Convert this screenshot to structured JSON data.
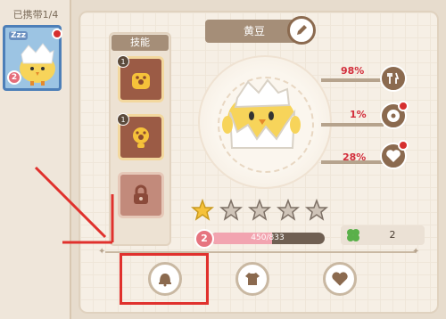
{
  "sidebar": {
    "title": "已携带1/4",
    "pet": {
      "sleep_text": "Zzz",
      "level": "2"
    }
  },
  "pet_name": "黄豆",
  "skills": {
    "title": "技能",
    "badge1": "1",
    "badge2": "1"
  },
  "stats": [
    {
      "value": "98%",
      "icon": "fork-knife-icon"
    },
    {
      "value": "1%",
      "icon": "donut-icon"
    },
    {
      "value": "28%",
      "icon": "heart-icon"
    }
  ],
  "stars": {
    "filled": 1,
    "total": 5
  },
  "level": {
    "value": "2",
    "exp_text": "450/833",
    "exp_fraction": 0.54
  },
  "clover": {
    "value": "2"
  },
  "colors": {
    "highlight": "#e0312d",
    "brown": "#8b6a4f",
    "stat_red": "#d22c3a"
  }
}
